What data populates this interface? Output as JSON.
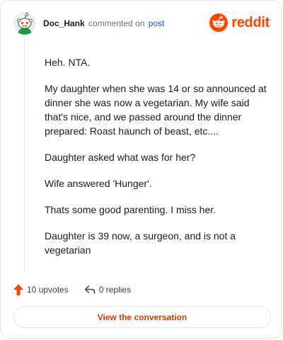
{
  "header": {
    "author": "Doc_Hank",
    "commented_text": "commented on",
    "post_link": "post",
    "brand": "reddit",
    "brand_color": "#ff4500"
  },
  "comment": {
    "paragraphs": [
      "Heh. NTA.",
      "My daughter when she was 14 or so announced at dinner she was now a vegetarian. My wife said that's nice, and we passed around the dinner prepared: Roast haunch of beast, etc....",
      "Daughter asked what was for her?",
      "Wife answered 'Hunger'.",
      "Thats some good parenting. I miss her.",
      "Daughter is 39 now, a surgeon, and is not a vegetarian"
    ]
  },
  "actions": {
    "upvotes": "10 upvotes",
    "replies": "0 replies",
    "upvote_icon": "upvote-arrow-icon",
    "reply_icon": "reply-arrow-icon"
  },
  "cta": {
    "label": "View the conversation",
    "color": "#d93a00"
  }
}
